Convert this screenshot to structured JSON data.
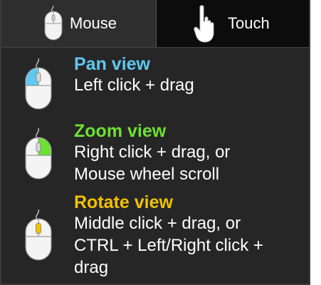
{
  "tabs": [
    {
      "label": "Mouse",
      "icon": "mouse-icon"
    },
    {
      "label": "Touch",
      "icon": "hand-pointer-icon"
    }
  ],
  "entries": [
    {
      "title": "Pan view",
      "description": [
        "Left click + drag"
      ],
      "color": "#5ec8f2",
      "icon": "mouse-left-button-icon"
    },
    {
      "title": "Zoom view",
      "description": [
        "Right click + drag, or",
        "Mouse wheel scroll"
      ],
      "color": "#6de132",
      "icon": "mouse-right-button-icon"
    },
    {
      "title": "Rotate view",
      "description": [
        "Middle click + drag, or",
        "CTRL + Left/Right click +",
        "drag"
      ],
      "color": "#f2c200",
      "icon": "mouse-middle-button-icon"
    }
  ],
  "colors": {
    "panel_background": "#262626",
    "active_tab": "#2e2e2e",
    "inactive_tab": "#0c0c0c",
    "text": "#ffffff"
  }
}
